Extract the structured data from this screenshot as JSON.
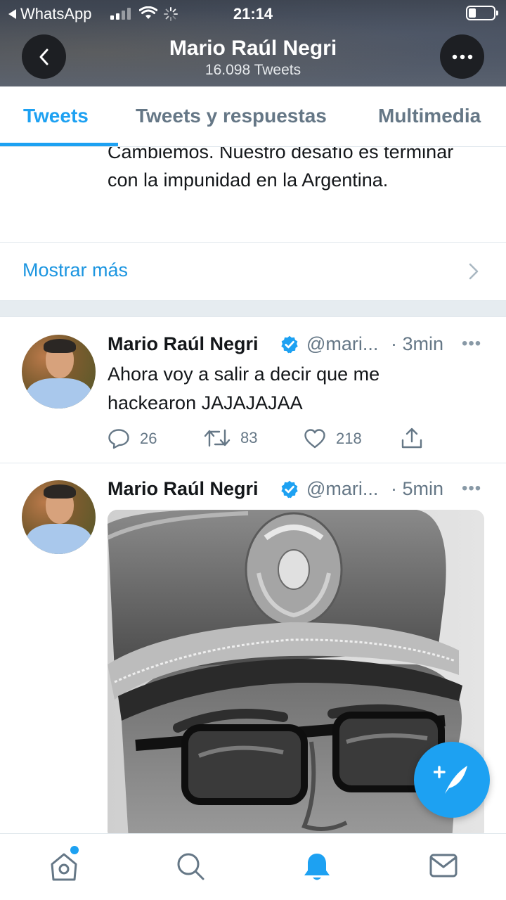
{
  "status_bar": {
    "back_app": "WhatsApp",
    "time": "21:14"
  },
  "header": {
    "title": "Mario Raúl Negri",
    "subtitle": "16.098 Tweets",
    "back_icon": "chevron-left-icon",
    "more_icon": "more-horizontal-icon"
  },
  "tabs": [
    {
      "label": "Tweets",
      "active": true
    },
    {
      "label": "Tweets y respuestas",
      "active": false
    },
    {
      "label": "Multimedia",
      "active": false
    }
  ],
  "clipped_tweet": {
    "lines": "Cambiemos. Nuestro desafío es terminar con la impunidad en la Argentina."
  },
  "show_more": {
    "label": "Mostrar más"
  },
  "tweets": [
    {
      "name": "Mario Raúl Negri",
      "handle": "@mari...",
      "time": "· 3min",
      "text": "Ahora voy a salir a decir que me hackearon JAJAJAJAA",
      "replies": "26",
      "retweets": "83",
      "likes": "218"
    },
    {
      "name": "Mario Raúl Negri",
      "handle": "@mari...",
      "time": "· 5min",
      "has_photo": true
    }
  ],
  "colors": {
    "accent": "#1da1f2",
    "text_secondary": "#657786"
  },
  "bottom_nav": [
    "home-icon",
    "search-icon",
    "notifications-bell-icon",
    "messages-envelope-icon"
  ],
  "fab_icon": "compose-tweet-icon"
}
